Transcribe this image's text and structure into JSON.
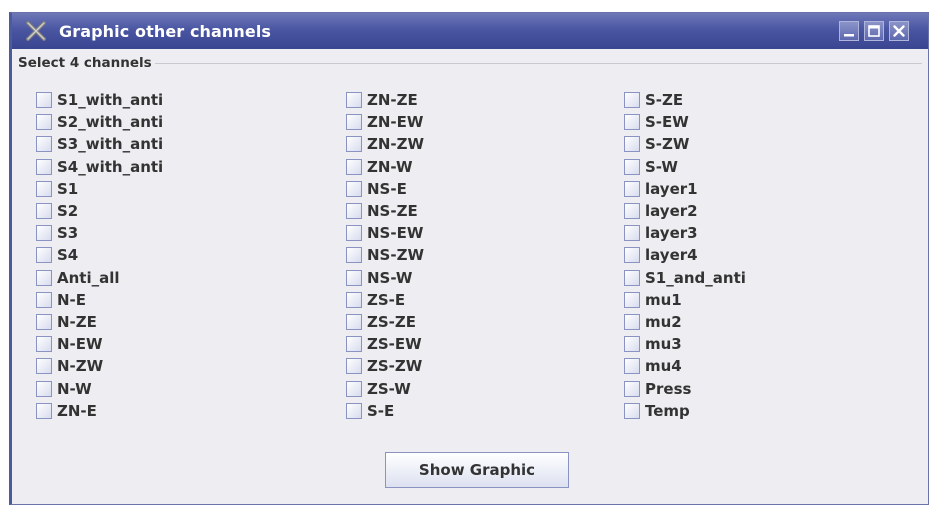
{
  "window": {
    "title": "Graphic other channels",
    "icon": "x-window-icon",
    "controls": [
      "minimize-icon",
      "maximize-icon",
      "close-icon"
    ]
  },
  "group": {
    "legend": "Select 4 channels"
  },
  "columns": [
    [
      "S1_with_anti",
      "S2_with_anti",
      "S3_with_anti",
      "S4_with_anti",
      "S1",
      "S2",
      "S3",
      "S4",
      "Anti_all",
      "N-E",
      "N-ZE",
      "N-EW",
      "N-ZW",
      "N-W",
      "ZN-E"
    ],
    [
      "ZN-ZE",
      "ZN-EW",
      "ZN-ZW",
      "ZN-W",
      "NS-E",
      "NS-ZE",
      "NS-EW",
      "NS-ZW",
      "NS-W",
      "ZS-E",
      "ZS-ZE",
      "ZS-EW",
      "ZS-ZW",
      "ZS-W",
      "S-E"
    ],
    [
      "S-ZE",
      "S-EW",
      "S-ZW",
      "S-W",
      "layer1",
      "layer2",
      "layer3",
      "layer4",
      "S1_and_anti",
      "mu1",
      "mu2",
      "mu3",
      "mu4",
      "Press",
      "Temp"
    ]
  ],
  "actions": {
    "show_graphic": "Show Graphic"
  },
  "colors": {
    "titlebar": "#4a56a2",
    "panel": "#eeeef2",
    "text": "#333333",
    "checkbox_border": "#8a93c2"
  }
}
